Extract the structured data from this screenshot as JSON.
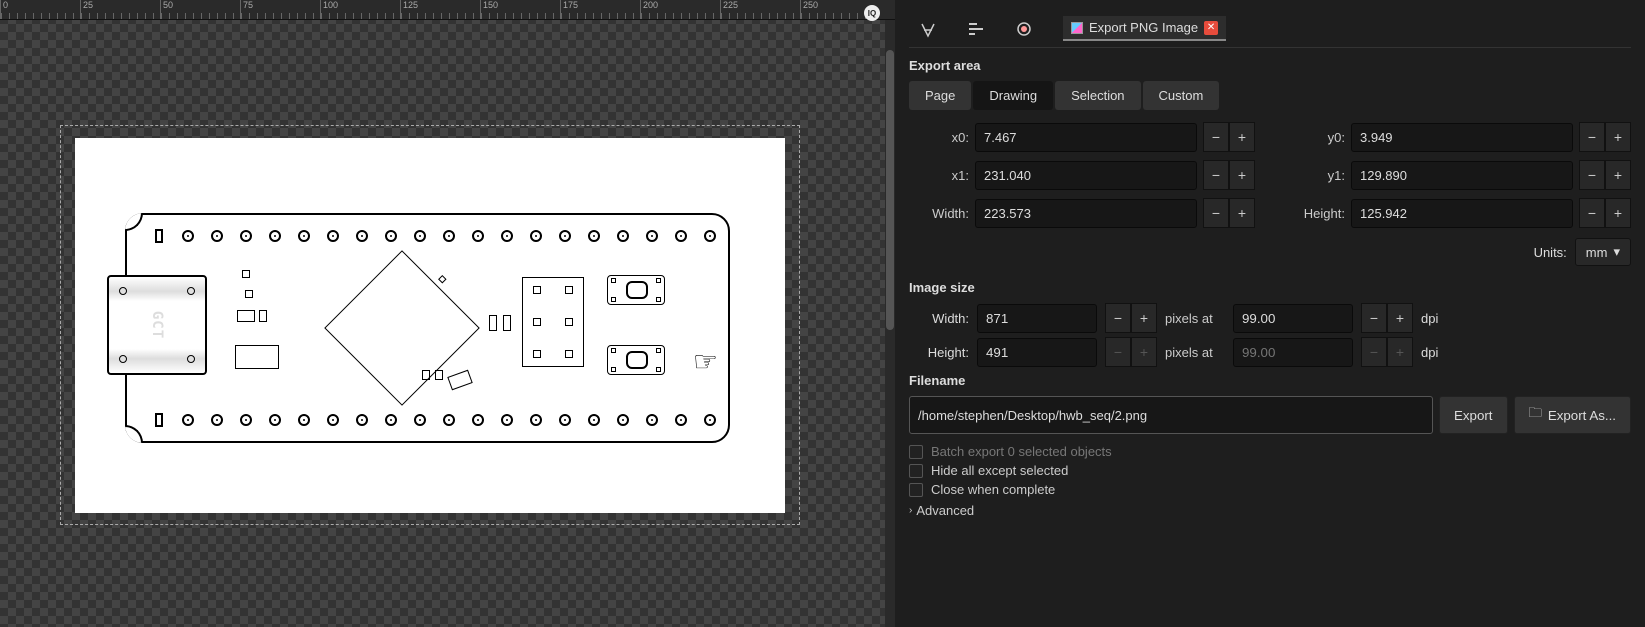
{
  "ruler": {
    "ticks": [
      "0",
      "25",
      "50",
      "75",
      "100",
      "125",
      "150",
      "175",
      "200",
      "225",
      "250"
    ]
  },
  "zoom_badge": "IQ",
  "pcb": {
    "usb_label": "GCT"
  },
  "tabs": {
    "export_label": "Export PNG Image"
  },
  "export": {
    "area_label": "Export area",
    "modes": {
      "page": "Page",
      "drawing": "Drawing",
      "selection": "Selection",
      "custom": "Custom"
    },
    "x0_label": "x0:",
    "x0": "7.467",
    "y0_label": "y0:",
    "y0": "3.949",
    "x1_label": "x1:",
    "x1": "231.040",
    "y1_label": "y1:",
    "y1": "129.890",
    "w_label": "Width:",
    "w": "223.573",
    "h_label": "Height:",
    "h": "125.942",
    "units_label": "Units:",
    "units": "mm"
  },
  "imgsize": {
    "label": "Image size",
    "w_label": "Width:",
    "w": "871",
    "h_label": "Height:",
    "h": "491",
    "px_label": "pixels at",
    "dpi1": "99.00",
    "dpi2": "99.00",
    "dpi_label": "dpi"
  },
  "file": {
    "label": "Filename",
    "path": "/home/stephen/Desktop/hwb_seq/2.png",
    "export": "Export",
    "export_as": "Export As..."
  },
  "opts": {
    "batch": "Batch export 0 selected objects",
    "hide": "Hide all except selected",
    "close": "Close when complete",
    "advanced": "Advanced"
  }
}
